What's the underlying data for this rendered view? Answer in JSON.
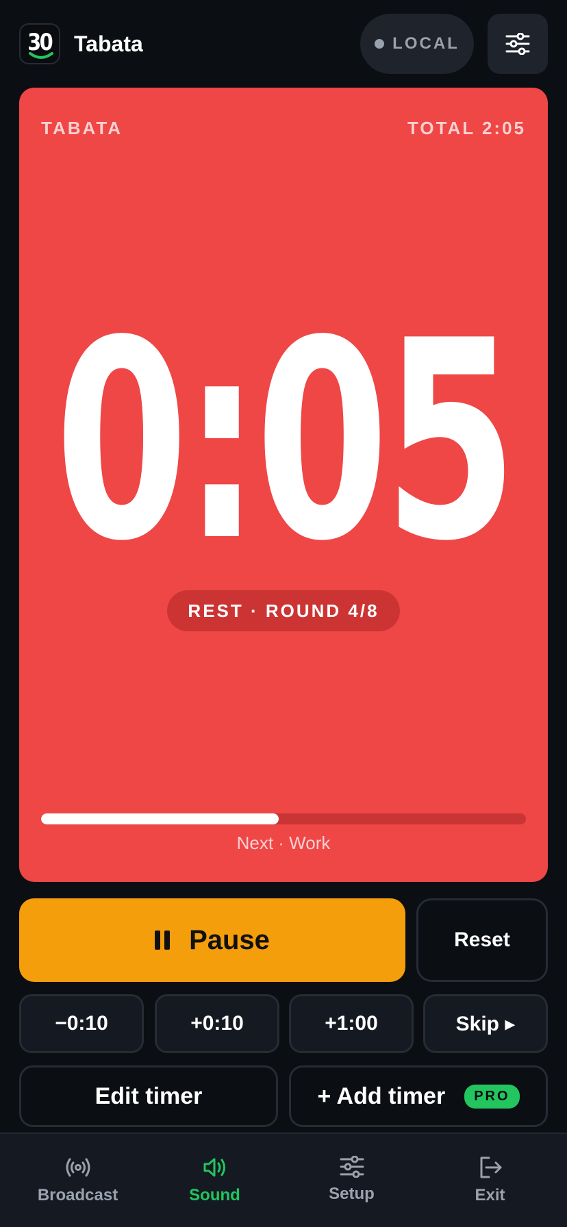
{
  "header": {
    "logo_text": "30",
    "title": "Tabata",
    "status_label": "LOCAL"
  },
  "timer": {
    "mode": "TABATA",
    "total": "TOTAL 2:05",
    "time": "0:05",
    "phase": "REST · ROUND 4/8",
    "progress": 0.49,
    "next": "Next · Work"
  },
  "controls": {
    "pause_label": "Pause",
    "reset_label": "Reset",
    "minus10_label": "−0:10",
    "plus10_label": "+0:10",
    "plus60_label": "+1:00",
    "skip_label": "Skip ▸",
    "edit_label": "Edit timer",
    "add_label": "+ Add timer",
    "pro_badge": "PRO"
  },
  "nav": {
    "items": [
      {
        "label": "Broadcast",
        "icon": "broadcast-icon"
      },
      {
        "label": "Sound",
        "icon": "speaker-icon",
        "active": true
      },
      {
        "label": "Setup",
        "icon": "sliders-icon"
      },
      {
        "label": "Exit",
        "icon": "exit-icon"
      }
    ]
  },
  "colors": {
    "background": "#0b0e13",
    "card_rest": "#ef4646",
    "pause_accent": "#f59e0b",
    "active_green": "#22c55e",
    "muted": "#9aa2ae"
  }
}
